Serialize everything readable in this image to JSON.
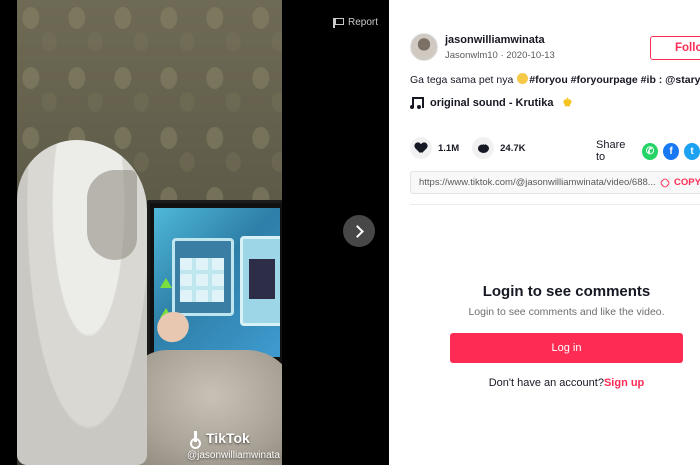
{
  "video": {
    "report_label": "Report",
    "watermark_brand": "TikTok",
    "watermark_handle": "@jasonwilliamwinata"
  },
  "author": {
    "username": "jasonwilliamwinata",
    "meta": "Jasonwlm10 · 2020-10-13",
    "follow_label": "Follo"
  },
  "caption": {
    "text_before": "Ga tega sama pet nya",
    "tags": "#foryou #foryourpage #ib : @staryu"
  },
  "sound": {
    "label": "original sound - Krutika",
    "badge": "♚"
  },
  "stats": {
    "likes": "1.1M",
    "comments": "24.7K"
  },
  "share": {
    "label": "Share to",
    "whatsapp": "✆",
    "facebook": "f",
    "twitter": "t"
  },
  "link": {
    "url": "https://www.tiktok.com/@jasonwilliamwinata/video/688...",
    "copy_label": "COPY"
  },
  "login": {
    "title": "Login to see comments",
    "subtitle": "Login to see comments and like the video.",
    "button": "Log in",
    "signup_prompt": "Don't have an account?",
    "signup_link": "Sign up"
  },
  "colors": {
    "accent": "#fe2c55",
    "whatsapp": "#25d366",
    "facebook": "#1877f2",
    "twitter": "#1da1f2"
  }
}
